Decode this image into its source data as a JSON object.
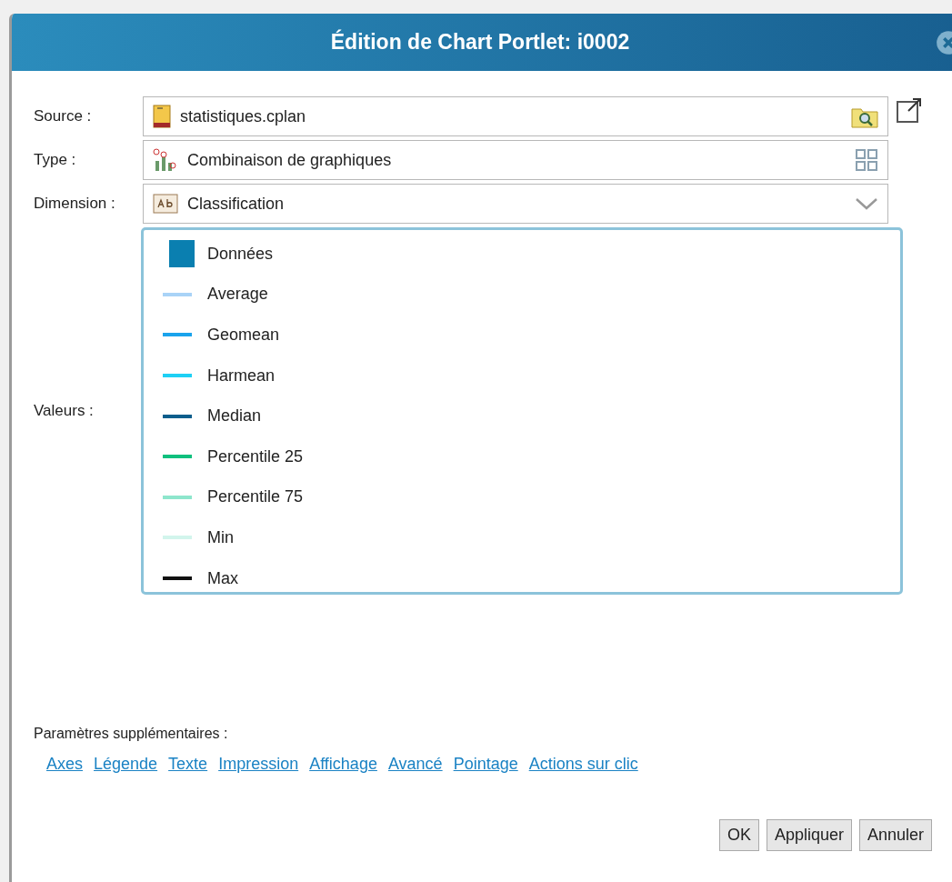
{
  "window": {
    "title": "Édition de Chart Portlet: i0002"
  },
  "fields": [
    {
      "kind": "source",
      "label": "Source :",
      "value": "statistiques.cplan"
    },
    {
      "kind": "type",
      "label": "Type :",
      "value": "Combinaison de graphiques"
    },
    {
      "kind": "dimension",
      "label": "Dimension :",
      "value": "Classification"
    }
  ],
  "values": {
    "label": "Valeurs :",
    "items": [
      {
        "kind": "bar",
        "name": "Données",
        "color": "#0a7fb0"
      },
      {
        "kind": "line",
        "name": "Average",
        "color": "#a9d3f7"
      },
      {
        "kind": "line",
        "name": "Geomean",
        "color": "#1aa3ec"
      },
      {
        "kind": "line",
        "name": "Harmean",
        "color": "#1ed0f5"
      },
      {
        "kind": "line",
        "name": "Median",
        "color": "#0c5e8c"
      },
      {
        "kind": "line",
        "name": "Percentile 25",
        "color": "#10c07e"
      },
      {
        "kind": "line",
        "name": "Percentile 75",
        "color": "#8ee6cc"
      },
      {
        "kind": "line",
        "name": "Min",
        "color": "#d2f5ec"
      },
      {
        "kind": "line",
        "name": "Max",
        "color": "#111111"
      }
    ]
  },
  "extra": {
    "label": "Paramètres supplémentaires :",
    "links": [
      "Axes",
      "Légende",
      "Texte",
      "Impression",
      "Affichage",
      "Avancé",
      "Pointage",
      "Actions sur clic"
    ]
  },
  "buttons": [
    "OK",
    "Appliquer",
    "Annuler"
  ]
}
